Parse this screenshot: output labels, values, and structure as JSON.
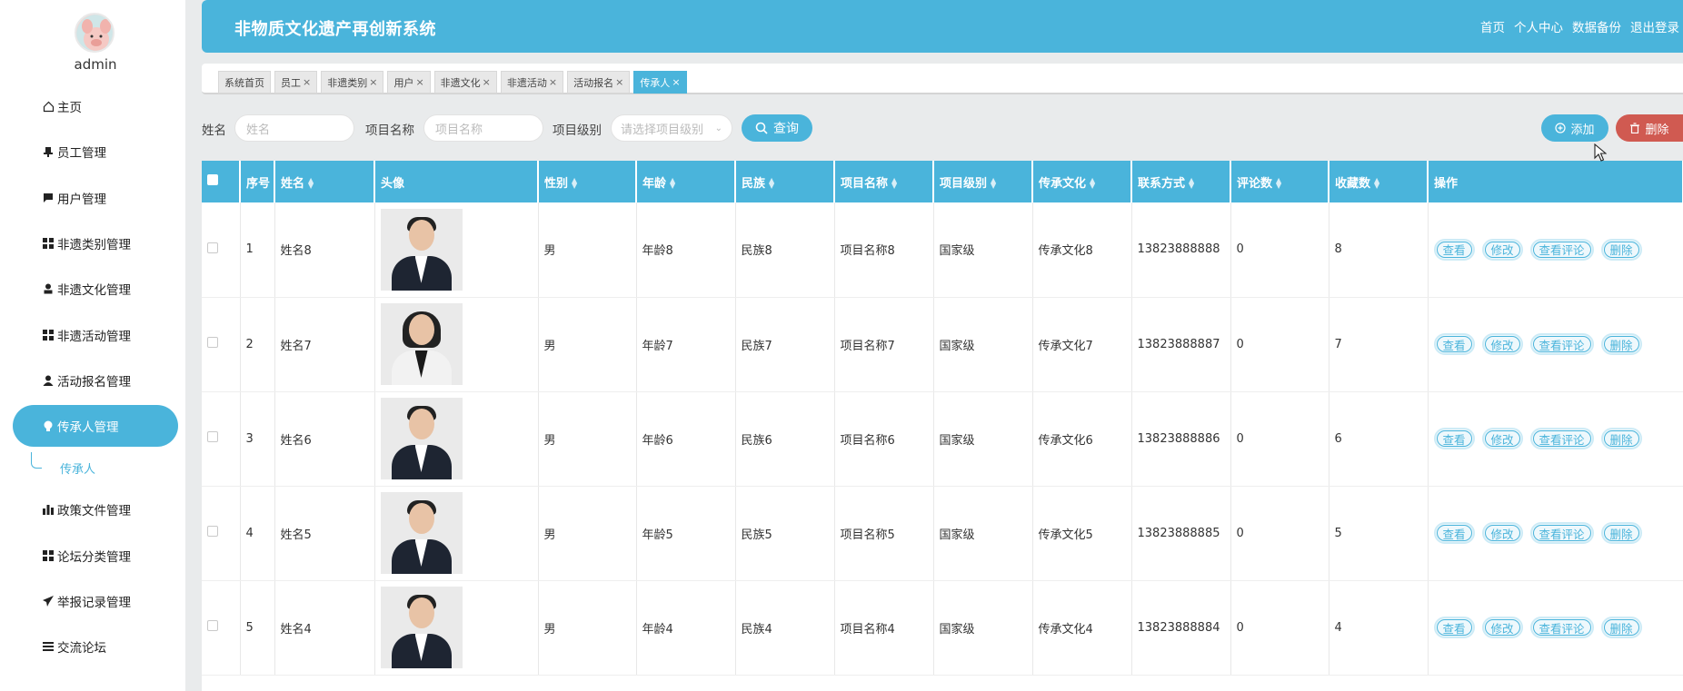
{
  "user": {
    "name": "admin"
  },
  "header": {
    "title": "非物质文化遗产再创新系统",
    "links": [
      "首页",
      "个人中心",
      "数据备份",
      "退出登录"
    ]
  },
  "menu": [
    {
      "label": "主页",
      "icon": "home-icon"
    },
    {
      "label": "员工管理",
      "icon": "stamp-icon"
    },
    {
      "label": "用户管理",
      "icon": "chat-icon"
    },
    {
      "label": "非遗类别管理",
      "icon": "grid-icon"
    },
    {
      "label": "非遗文化管理",
      "icon": "user-icon"
    },
    {
      "label": "非遗活动管理",
      "icon": "grid-icon"
    },
    {
      "label": "活动报名管理",
      "icon": "person-icon"
    },
    {
      "label": "传承人管理",
      "icon": "bulb-icon",
      "active": true
    },
    {
      "label": "政策文件管理",
      "icon": "bar-chart-icon"
    },
    {
      "label": "论坛分类管理",
      "icon": "grid-icon"
    },
    {
      "label": "举报记录管理",
      "icon": "send-icon"
    },
    {
      "label": "交流论坛",
      "icon": "list-icon"
    }
  ],
  "submenu": {
    "label": "传承人"
  },
  "tabs": [
    {
      "label": "系统首页",
      "closable": false
    },
    {
      "label": "员工",
      "closable": true
    },
    {
      "label": "非遗类别",
      "closable": true
    },
    {
      "label": "用户",
      "closable": true
    },
    {
      "label": "非遗文化",
      "closable": true
    },
    {
      "label": "非遗活动",
      "closable": true
    },
    {
      "label": "活动报名",
      "closable": true
    },
    {
      "label": "传承人",
      "closable": true,
      "active": true
    }
  ],
  "search": {
    "name_label": "姓名",
    "name_placeholder": "姓名",
    "project_label": "项目名称",
    "project_placeholder": "项目名称",
    "level_label": "项目级别",
    "level_placeholder": "请选择项目级别",
    "query_label": "查询",
    "add_label": "添加",
    "delete_label": "删除"
  },
  "table": {
    "columns": [
      "序号",
      "姓名",
      "头像",
      "性别",
      "年龄",
      "民族",
      "项目名称",
      "项目级别",
      "传承文化",
      "联系方式",
      "评论数",
      "收藏数",
      "操作"
    ],
    "sortable": [
      false,
      true,
      false,
      true,
      true,
      true,
      true,
      true,
      true,
      true,
      true,
      true,
      false
    ],
    "rows": [
      {
        "index": "1",
        "name": "姓名8",
        "gender": "男",
        "age": "年龄8",
        "ethnic": "民族8",
        "project": "项目名称8",
        "level": "国家级",
        "culture": "传承文化8",
        "phone": "13823888888",
        "comments": "0",
        "favorites": "8",
        "photo": "male"
      },
      {
        "index": "2",
        "name": "姓名7",
        "gender": "男",
        "age": "年龄7",
        "ethnic": "民族7",
        "project": "项目名称7",
        "level": "国家级",
        "culture": "传承文化7",
        "phone": "13823888887",
        "comments": "0",
        "favorites": "7",
        "photo": "female"
      },
      {
        "index": "3",
        "name": "姓名6",
        "gender": "男",
        "age": "年龄6",
        "ethnic": "民族6",
        "project": "项目名称6",
        "level": "国家级",
        "culture": "传承文化6",
        "phone": "13823888886",
        "comments": "0",
        "favorites": "6",
        "photo": "male"
      },
      {
        "index": "4",
        "name": "姓名5",
        "gender": "男",
        "age": "年龄5",
        "ethnic": "民族5",
        "project": "项目名称5",
        "level": "国家级",
        "culture": "传承文化5",
        "phone": "13823888885",
        "comments": "0",
        "favorites": "5",
        "photo": "male"
      },
      {
        "index": "5",
        "name": "姓名4",
        "gender": "男",
        "age": "年龄4",
        "ethnic": "民族4",
        "project": "项目名称4",
        "level": "国家级",
        "culture": "传承文化4",
        "phone": "13823888884",
        "comments": "0",
        "favorites": "4",
        "photo": "male"
      }
    ],
    "actions": [
      "查看",
      "修改",
      "查看评论",
      "删除"
    ]
  },
  "colors": {
    "accent": "#4ab4db",
    "danger": "#d05a51",
    "background": "#e9ebec"
  }
}
